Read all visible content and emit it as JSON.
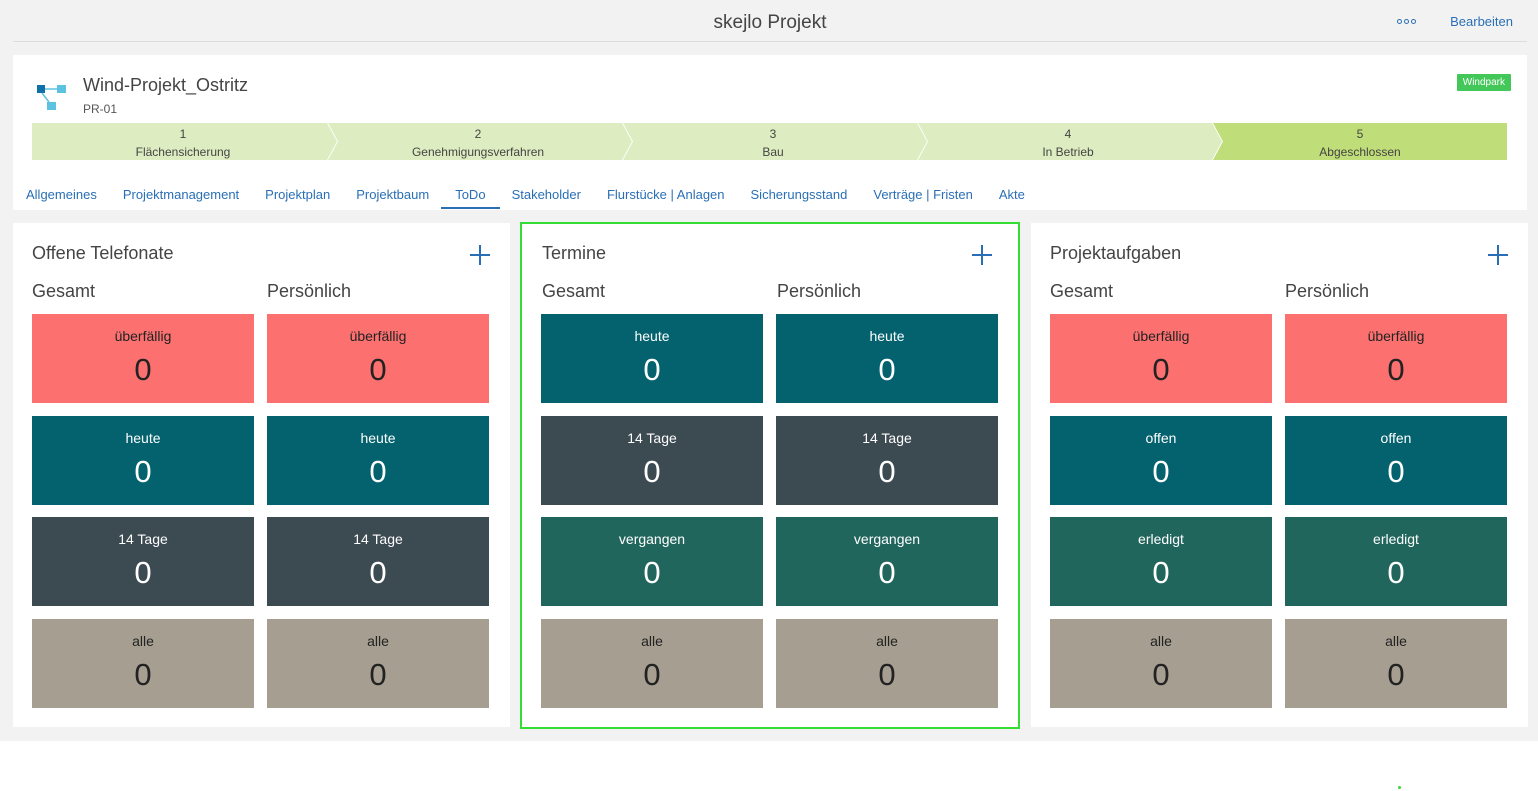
{
  "app_title": "skejlo Projekt",
  "header_actions": {
    "more_icon": "more-horizontal-icon",
    "edit_label": "Bearbeiten"
  },
  "project": {
    "name": "Wind-Projekt_Ostritz",
    "code": "PR-01",
    "badge": "Windpark",
    "icon": "project-tree-icon"
  },
  "phases": [
    {
      "num": "1",
      "label": "Flächensicherung"
    },
    {
      "num": "2",
      "label": "Genehmigungsverfahren"
    },
    {
      "num": "3",
      "label": "Bau"
    },
    {
      "num": "4",
      "label": "In Betrieb"
    },
    {
      "num": "5",
      "label": "Abgeschlossen"
    }
  ],
  "tabs": [
    "Allgemeines",
    "Projektmanagement",
    "Projektplan",
    "Projektbaum",
    "ToDo",
    "Stakeholder",
    "Flurstücke | Anlagen",
    "Sicherungsstand",
    "Verträge | Fristen",
    "Akte"
  ],
  "active_tab": "ToDo",
  "colors": {
    "accent": "#2a6fb5",
    "red": "#fc7070",
    "teal": "#03626e",
    "dark": "#3c4a52",
    "green": "#20665c",
    "taupe": "#a69f91",
    "badge": "#44c759",
    "phase_light": "#deedc1",
    "phase_done": "#bfdd78",
    "highlight": "#33dd33"
  },
  "panels": [
    {
      "title": "Offene Telefonate",
      "col1": "Gesamt",
      "col2": "Persönlich",
      "tiles": [
        {
          "label": "überfällig",
          "value": "0",
          "color": "red"
        },
        {
          "label": "heute",
          "value": "0",
          "color": "teal"
        },
        {
          "label": "14 Tage",
          "value": "0",
          "color": "dark"
        },
        {
          "label": "alle",
          "value": "0",
          "color": "taupe"
        }
      ]
    },
    {
      "title": "Termine",
      "col1": "Gesamt",
      "col2": "Persönlich",
      "tiles": [
        {
          "label": "heute",
          "value": "0",
          "color": "teal"
        },
        {
          "label": "14 Tage",
          "value": "0",
          "color": "dark"
        },
        {
          "label": "vergangen",
          "value": "0",
          "color": "green"
        },
        {
          "label": "alle",
          "value": "0",
          "color": "taupe"
        }
      ]
    },
    {
      "title": "Projektaufgaben",
      "col1": "Gesamt",
      "col2": "Persönlich",
      "tiles": [
        {
          "label": "überfällig",
          "value": "0",
          "color": "red"
        },
        {
          "label": "offen",
          "value": "0",
          "color": "teal"
        },
        {
          "label": "erledigt",
          "value": "0",
          "color": "green"
        },
        {
          "label": "alle",
          "value": "0",
          "color": "taupe"
        }
      ]
    }
  ]
}
